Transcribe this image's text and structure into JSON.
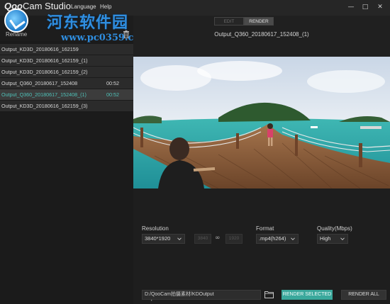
{
  "app": {
    "logo_q": "Qoo",
    "logo_rest": "Cam Studio",
    "menu": [
      "Language",
      "Help"
    ]
  },
  "watermark": {
    "title": "河东软件园",
    "url": "www.pc0359.cn"
  },
  "left_panel": {
    "rename_label": "Rename",
    "files": [
      {
        "name": "Output_KD3D_20180616_162159",
        "duration": ""
      },
      {
        "name": "Output_KD3D_20180616_162159_(1)",
        "duration": ""
      },
      {
        "name": "Output_KD3D_20180616_162159_(2)",
        "duration": ""
      },
      {
        "name": "Output_Q360_20180617_152408",
        "duration": "00:52"
      },
      {
        "name": "Output_Q360_20180617_152408_(1)",
        "duration": "00:52"
      },
      {
        "name": "Output_KD3D_20180616_162159_(3)",
        "duration": ""
      }
    ],
    "selected_index": 4
  },
  "main": {
    "tabs": {
      "edit": "EDIT",
      "render": "RENDER"
    },
    "active_tab": "render",
    "video_title": "Output_Q360_20180617_152408_(1)"
  },
  "settings": {
    "resolution_label": "Resolution",
    "resolution_value": "3840*1920",
    "width_placeholder": "3840",
    "height_placeholder": "1920",
    "format_label": "Format",
    "format_value": ".mp4(h264)",
    "quality_label": "Quality(Mbps)",
    "quality_value": "High",
    "output_label": "Output:",
    "output_path": "D:/QooCam拍摄素材/KDOutput",
    "render_selected": "RENDER SELECTED",
    "render_all": "RENDER ALL"
  },
  "colors": {
    "accent": "#3aa89c",
    "selected_text": "#4fc1b8"
  }
}
